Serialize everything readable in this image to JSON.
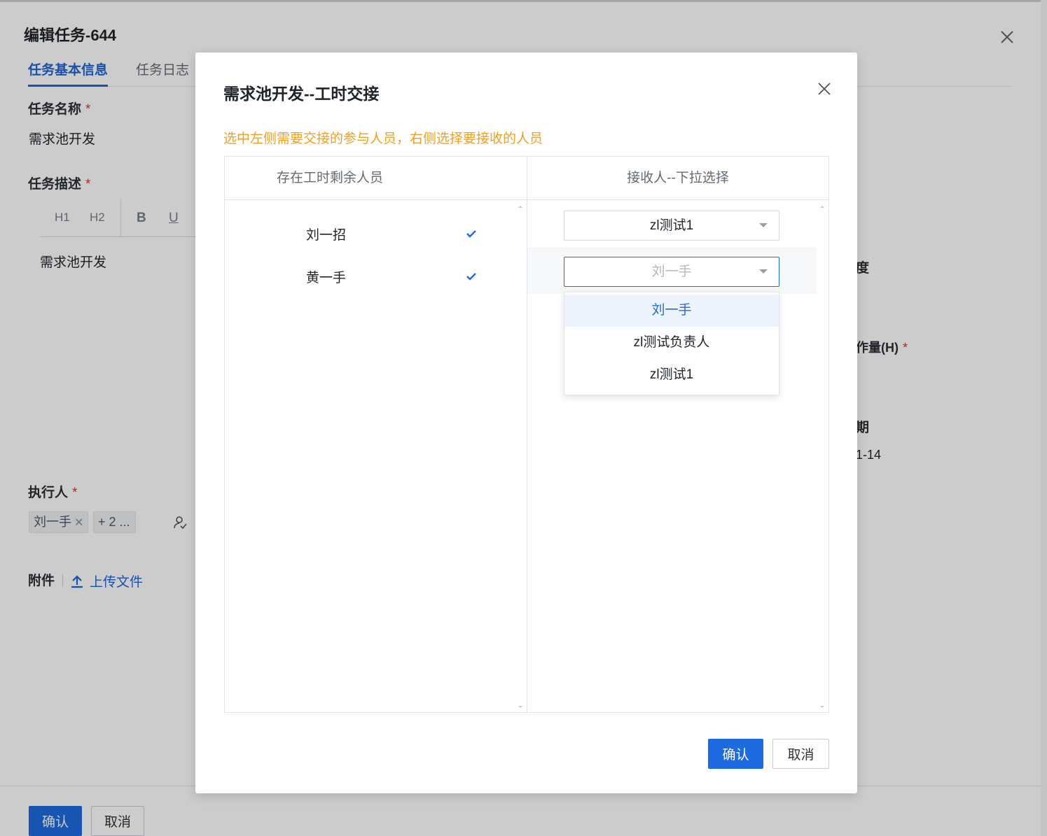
{
  "background": {
    "title": "编辑任务-644",
    "tabs": [
      "任务基本信息",
      "任务日志"
    ],
    "task_name_label": "任务名称",
    "task_name_value": "需求池开发",
    "task_desc_label": "任务描述",
    "toolbar": [
      "H1",
      "H2",
      "B",
      "U"
    ],
    "desc_content": "需求池开发",
    "executor_label": "执行人",
    "executor_tag": "刘一手",
    "executor_more": "+ 2 ...",
    "attachment_label": "附件",
    "upload_label": "上传文件",
    "right_labels": {
      "progress": "度",
      "workload": "作量(H)",
      "date": "期",
      "date_value": "1-14"
    },
    "confirm_label": "确认",
    "cancel_label": "取消"
  },
  "modal": {
    "title": "需求池开发--工时交接",
    "hint": "选中左侧需要交接的参与人员，右侧选择要接收的人员",
    "left_header": "存在工时剩余人员",
    "right_header": "接收人--下拉选择",
    "left_rows": [
      {
        "name": "刘一招",
        "checked": true
      },
      {
        "name": "黄一手",
        "checked": true
      }
    ],
    "right_selects": [
      {
        "value": "zl测试1"
      },
      {
        "value": "刘一手",
        "placeholder": true
      }
    ],
    "dropdown_options": [
      "刘一手",
      "zl测试负责人",
      "zl测试1"
    ],
    "confirm_label": "确认",
    "cancel_label": "取消"
  },
  "colors": {
    "primary": "#1e6be0",
    "hint": "#f0a020",
    "required": "#e0312b"
  }
}
